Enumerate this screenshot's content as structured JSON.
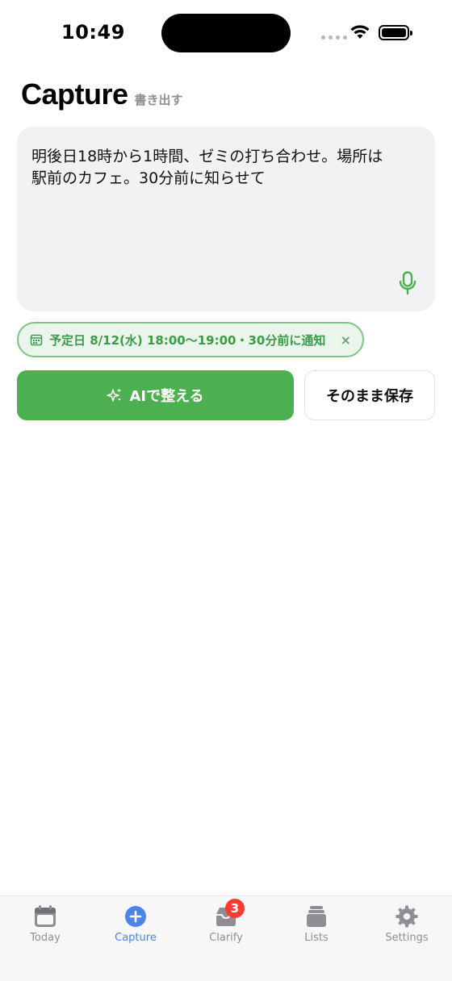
{
  "status_bar": {
    "time": "10:49"
  },
  "header": {
    "title": "Capture",
    "subtitle": "書き出す"
  },
  "editor": {
    "text": "明後日18時から1時間、ゼミの打ち合わせ。場所は\n駅前のカフェ。30分前に知らせて",
    "mic_icon": "microphone-icon"
  },
  "chip": {
    "icon": "calendar-icon",
    "label": "予定日 8/12(水) 18:00〜19:00・30分前に通知",
    "close": "×"
  },
  "actions": {
    "ai_label": "AIで整える",
    "ai_icon": "sparkles-icon",
    "save_label": "そのまま保存"
  },
  "tabbar": {
    "items": [
      {
        "label": "Today",
        "icon": "calendar-icon"
      },
      {
        "label": "Capture",
        "icon": "plus-circle-icon",
        "active": true
      },
      {
        "label": "Clarify",
        "icon": "tray-icon",
        "badge": "3"
      },
      {
        "label": "Lists",
        "icon": "stack-icon"
      },
      {
        "label": "Settings",
        "icon": "gear-icon"
      }
    ]
  },
  "colors": {
    "accent_green": "#4caf50",
    "active_tab": "#4a86e8",
    "badge_red": "#ff3b30"
  }
}
